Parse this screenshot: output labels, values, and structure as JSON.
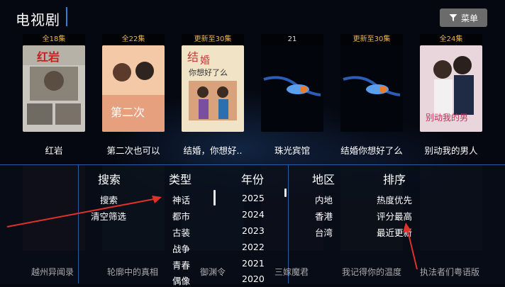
{
  "header": {
    "title": "电视剧",
    "menu_label": "菜单"
  },
  "top_row": [
    {
      "title": "红岩",
      "badge": "全18集",
      "badge_color": "#f0b642"
    },
    {
      "title": "第二次也可以",
      "badge": "全22集",
      "badge_color": "#f0b642"
    },
    {
      "title": "结婚，你想好..",
      "badge": "更新至30集",
      "badge_color": "#f0b642"
    },
    {
      "title": "珠光宾馆",
      "badge": "21",
      "badge_color": "#dddddd"
    },
    {
      "title": "结婚你想好了么",
      "badge": "更新至30集",
      "badge_color": "#f0b642"
    },
    {
      "title": "别动我的男人",
      "badge": "全24集",
      "badge_color": "#f0b642"
    }
  ],
  "bottom_row_titles": [
    "越州异闻录",
    "轮廓中的真相",
    "御渊令",
    "三嫁魔君",
    "我记得你的温度",
    "执法者们粤语版"
  ],
  "filters": {
    "search": {
      "header": "搜索",
      "items": [
        "搜索",
        "清空筛选"
      ]
    },
    "type": {
      "header": "类型",
      "items": [
        "神话",
        "都市",
        "古装",
        "战争",
        "青春",
        "偶像"
      ]
    },
    "year": {
      "header": "年份",
      "items": [
        "2025",
        "2024",
        "2023",
        "2022",
        "2021",
        "2020"
      ]
    },
    "region": {
      "header": "地区",
      "items": [
        "内地",
        "香港",
        "台湾"
      ]
    },
    "sort": {
      "header": "排序",
      "items": [
        "热度优先",
        "评分最高",
        "最近更新"
      ]
    }
  },
  "colors": {
    "accent_blue": "#2a5aa0",
    "badge_gold": "#f0b642",
    "annotation_red": "#e0302a"
  }
}
